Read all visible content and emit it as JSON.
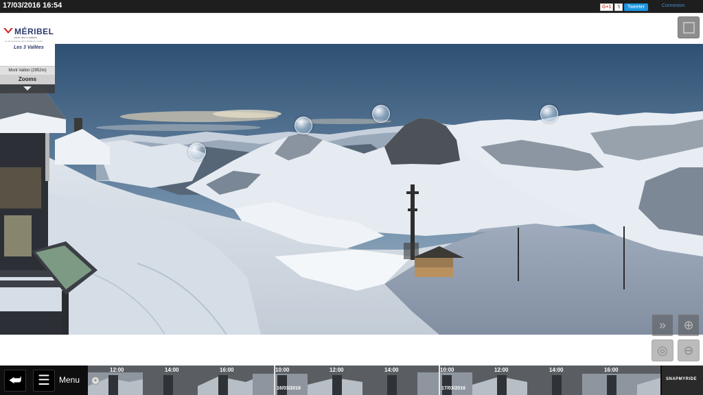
{
  "header": {
    "datetime": "17/03/2016 16:54",
    "gplus_label": "G+1",
    "gplus_count": "5",
    "tweet_label": "Tweeter",
    "login_label": "Connexion"
  },
  "logo": {
    "brand": "MÉRIBEL",
    "subtitle": "cœur des 3 vallées",
    "tagline": "Le plus grand domaine skiable du monde",
    "secondary": "Les 3 Vallées"
  },
  "sidebar": {
    "peak_label": "Mont Vallon (2952m)",
    "zooms_label": "Zooms"
  },
  "bottom": {
    "menu_label": "Menu",
    "brand": "SNAPMYRIDE"
  },
  "timeline": {
    "ticks": [
      "12:00",
      "14:00",
      "16:00",
      "10:00",
      "12:00",
      "14:00",
      "10:00",
      "12:00",
      "14:00",
      "16:00"
    ],
    "days": [
      "16/03/2016",
      "17/03/2016"
    ]
  },
  "colors": {
    "sky_top": "#2f5073",
    "sky_bottom": "#8ea7bf",
    "snow": "#e9edf2",
    "topbar": "#1e1e1e",
    "tweet": "#1b95e0"
  }
}
